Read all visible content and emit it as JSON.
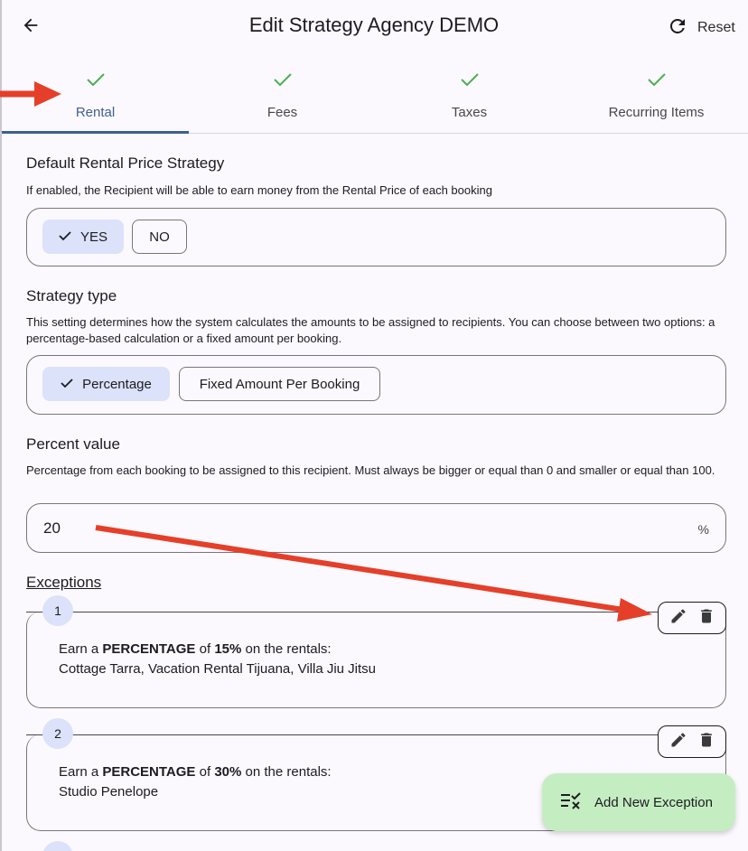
{
  "header": {
    "title": "Edit Strategy Agency DEMO",
    "reset_label": "Reset",
    "back_icon": "arrow-back-icon",
    "reset_icon": "refresh-icon"
  },
  "tabs": [
    {
      "label": "Rental",
      "active": true
    },
    {
      "label": "Fees",
      "active": false
    },
    {
      "label": "Taxes",
      "active": false
    },
    {
      "label": "Recurring Items",
      "active": false
    }
  ],
  "rental_price": {
    "title": "Default Rental Price Strategy",
    "description": "If enabled, the Recipient will be able to earn money from the Rental Price of each booking",
    "options": [
      "YES",
      "NO"
    ],
    "selected": "YES"
  },
  "strategy_type": {
    "title": "Strategy type",
    "description": "This setting determines how the system calculates the amounts to be assigned to recipients. You can choose between two options: a percentage-based calculation or a fixed amount per booking.",
    "options": [
      "Percentage",
      "Fixed Amount Per Booking"
    ],
    "selected": "Percentage"
  },
  "percent_value": {
    "title": "Percent value",
    "description": "Percentage from each booking to be assigned to this recipient. Must always be bigger or equal than 0 and smaller or equal than 100.",
    "value": "20",
    "suffix": "%"
  },
  "exceptions": {
    "label": "Exceptions",
    "items": [
      {
        "number": "1",
        "prefix": "Earn a",
        "type": "PERCENTAGE",
        "of": "of",
        "amount": "15%",
        "suffix": "on the rentals:",
        "rentals": "Cottage Tarra, Vacation Rental Tijuana, Villa Jiu Jitsu"
      },
      {
        "number": "2",
        "prefix": "Earn a",
        "type": "PERCENTAGE",
        "of": "of",
        "amount": "30%",
        "suffix": "on the rentals:",
        "rentals": "Studio Penelope"
      }
    ]
  },
  "fab": {
    "label": "Add New Exception",
    "icon": "checklist-add-icon"
  },
  "colors": {
    "accent": "#3f5f91",
    "check_green": "#4caf50",
    "selected_segment": "#dbe2f9",
    "fab_bg": "#c4eec1",
    "annotation_red": "#e53f2a"
  }
}
